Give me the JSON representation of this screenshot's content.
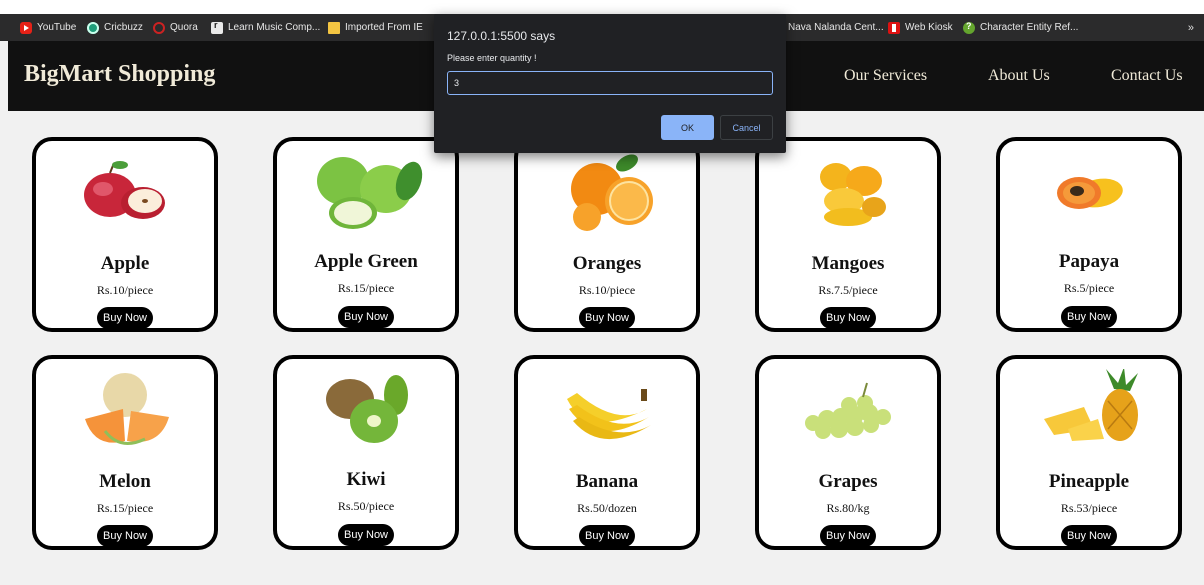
{
  "bookmarks": [
    {
      "label": "YouTube",
      "icon": "youtube-icon"
    },
    {
      "label": "Cricbuzz",
      "icon": "cricbuzz-icon"
    },
    {
      "label": "Quora",
      "icon": "quora-icon"
    },
    {
      "label": "Learn Music Comp...",
      "icon": "music-app-icon"
    },
    {
      "label": "Imported From IE",
      "icon": "folder-icon"
    },
    {
      "label": "Nava Nalanda Cent...",
      "icon": "nava-nalanda-icon"
    },
    {
      "label": "Web Kiosk",
      "icon": "web-kiosk-icon"
    },
    {
      "label": "Character Entity Ref...",
      "icon": "character-entity-icon"
    }
  ],
  "bookmarks_more": "»",
  "site": {
    "brand": "BigMart Shopping",
    "nav": [
      "Our Services",
      "About Us",
      "Contact Us"
    ]
  },
  "products": [
    {
      "name": "Apple",
      "price": "Rs.10/piece",
      "buy": "Buy Now"
    },
    {
      "name": "Apple Green",
      "price": "Rs.15/piece",
      "buy": "Buy Now"
    },
    {
      "name": "Oranges",
      "price": "Rs.10/piece",
      "buy": "Buy Now"
    },
    {
      "name": "Mangoes",
      "price": "Rs.7.5/piece",
      "buy": "Buy Now"
    },
    {
      "name": "Papaya",
      "price": "Rs.5/piece",
      "buy": "Buy Now"
    },
    {
      "name": "Melon",
      "price": "Rs.15/piece",
      "buy": "Buy Now"
    },
    {
      "name": "Kiwi",
      "price": "Rs.50/piece",
      "buy": "Buy Now"
    },
    {
      "name": "Banana",
      "price": "Rs.50/dozen",
      "buy": "Buy Now"
    },
    {
      "name": "Grapes",
      "price": "Rs.80/kg",
      "buy": "Buy Now"
    },
    {
      "name": "Pineapple",
      "price": "Rs.53/piece",
      "buy": "Buy Now"
    }
  ],
  "dialog": {
    "title": "127.0.0.1:5500 says",
    "message": "Please enter quantity !",
    "input_value": "3",
    "ok_label": "OK",
    "cancel_label": "Cancel"
  },
  "colors": {
    "nav_bg": "#111111",
    "brand_text": "#f0ead8",
    "page_bg": "#f1f1f1",
    "buy_button": "#000000",
    "dialog_bg": "#202124",
    "dialog_accent": "#8ab4f8"
  }
}
